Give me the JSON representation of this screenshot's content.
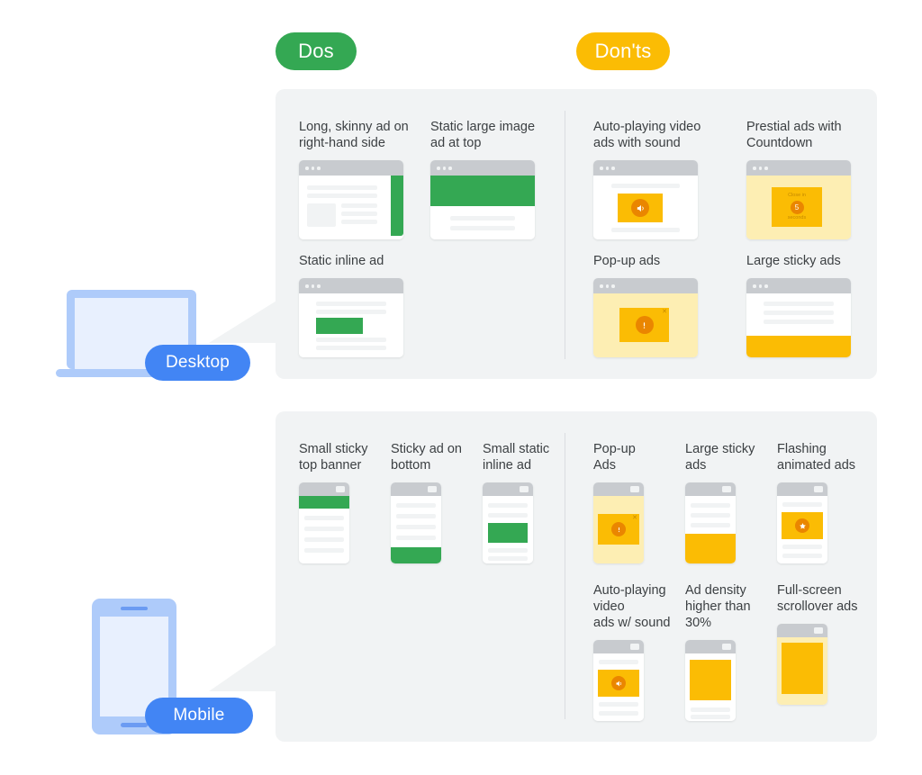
{
  "headings": {
    "dos": "Dos",
    "donts": "Don'ts"
  },
  "colors": {
    "green": "#34a853",
    "yellow": "#fbbc04",
    "blue": "#4285f4",
    "panel_bg": "#f1f3f4",
    "chrome_gray": "#c8cbcf",
    "icon_orange": "#ea8600",
    "tint_yellow": "#fdeeb3"
  },
  "devices": [
    {
      "id": "desktop",
      "badge": "Desktop"
    },
    {
      "id": "mobile",
      "badge": "Mobile"
    }
  ],
  "desktop": {
    "dos": [
      {
        "label": "Long, skinny ad on\nright-hand side",
        "mock": "browser-right-rail"
      },
      {
        "label": "Static large image\nad at top",
        "mock": "browser-top-banner"
      },
      {
        "label": "Static inline ad",
        "mock": "browser-inline"
      }
    ],
    "donts": [
      {
        "label": "Auto-playing video\nads with sound",
        "mock": "browser-video-sound",
        "icon": "speaker-icon"
      },
      {
        "label": "Prestial ads with\nCountdown",
        "mock": "browser-countdown",
        "countdown": {
          "before": "Close in",
          "number": "5",
          "after": "seconds"
        }
      },
      {
        "label": "Pop-up ads",
        "mock": "browser-popup",
        "icon": "alert-icon"
      },
      {
        "label": "Large sticky ads",
        "mock": "browser-sticky"
      }
    ]
  },
  "mobile": {
    "dos": [
      {
        "label": "Small sticky\ntop banner",
        "mock": "phone-top-banner"
      },
      {
        "label": "Sticky ad on\nbottom",
        "mock": "phone-bottom-sticky"
      },
      {
        "label": "Small static\ninline ad",
        "mock": "phone-inline"
      }
    ],
    "donts": [
      {
        "label": "Pop-up\nAds",
        "mock": "phone-popup",
        "icon": "alert-icon"
      },
      {
        "label": "Large sticky\nads",
        "mock": "phone-large-sticky"
      },
      {
        "label": "Flashing\nanimated ads",
        "mock": "phone-flashing",
        "icon": "star-icon"
      },
      {
        "label": "Auto-playing\nvideo\nads w/ sound",
        "mock": "phone-video-sound",
        "icon": "speaker-icon"
      },
      {
        "label": "Ad density\nhigher than\n30%",
        "mock": "phone-density"
      },
      {
        "label": "Full-screen\nscrollover ads",
        "mock": "phone-fullscreen"
      }
    ]
  }
}
